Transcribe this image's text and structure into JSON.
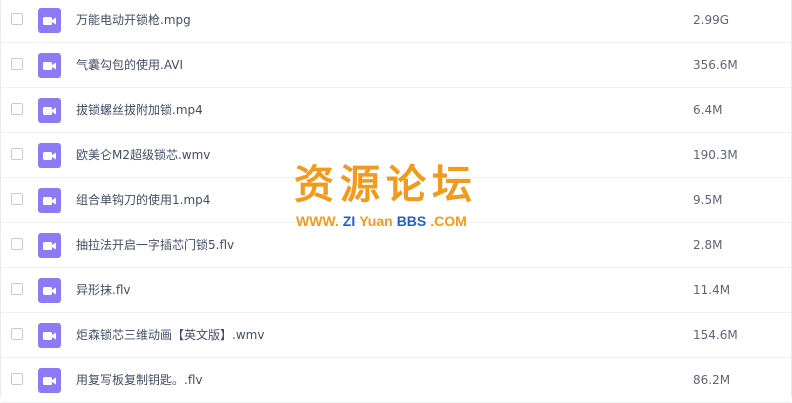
{
  "colors": {
    "icon_purple": "#8b7cf6",
    "watermark_orange": "#f29a1e",
    "watermark_blue": "#1f62c9",
    "text": "#424e67"
  },
  "files": [
    {
      "name": "万能电动开锁枪.mpg",
      "size": "2.99G",
      "icon": "video-file-icon"
    },
    {
      "name": "气囊勾包的使用.AVI",
      "size": "356.6M",
      "icon": "video-file-icon"
    },
    {
      "name": "拔锁螺丝拔附加锁.mp4",
      "size": "6.4M",
      "icon": "video-file-icon"
    },
    {
      "name": "欧美仑M2超级锁芯.wmv",
      "size": "190.3M",
      "icon": "video-file-icon"
    },
    {
      "name": "组合单钩刀的使用1.mp4",
      "size": "9.5M",
      "icon": "video-file-icon"
    },
    {
      "name": "抽拉法开启一字插芯门锁5.flv",
      "size": "2.8M",
      "icon": "video-file-icon"
    },
    {
      "name": "异形抹.flv",
      "size": "11.4M",
      "icon": "video-file-icon"
    },
    {
      "name": "炬森锁芯三维动画【英文版】.wmv",
      "size": "154.6M",
      "icon": "video-file-icon"
    },
    {
      "name": "用复写板复制钥匙。.flv",
      "size": "86.2M",
      "icon": "video-file-icon"
    }
  ],
  "watermark": {
    "title": "资源论坛",
    "url_parts": [
      {
        "text": "WWW.",
        "color": "orange"
      },
      {
        "text": "ZI",
        "color": "blue"
      },
      {
        "text": "Yuan",
        "color": "orange"
      },
      {
        "text": "BBS",
        "color": "blue"
      },
      {
        "text": ".COM",
        "color": "orange"
      }
    ]
  }
}
